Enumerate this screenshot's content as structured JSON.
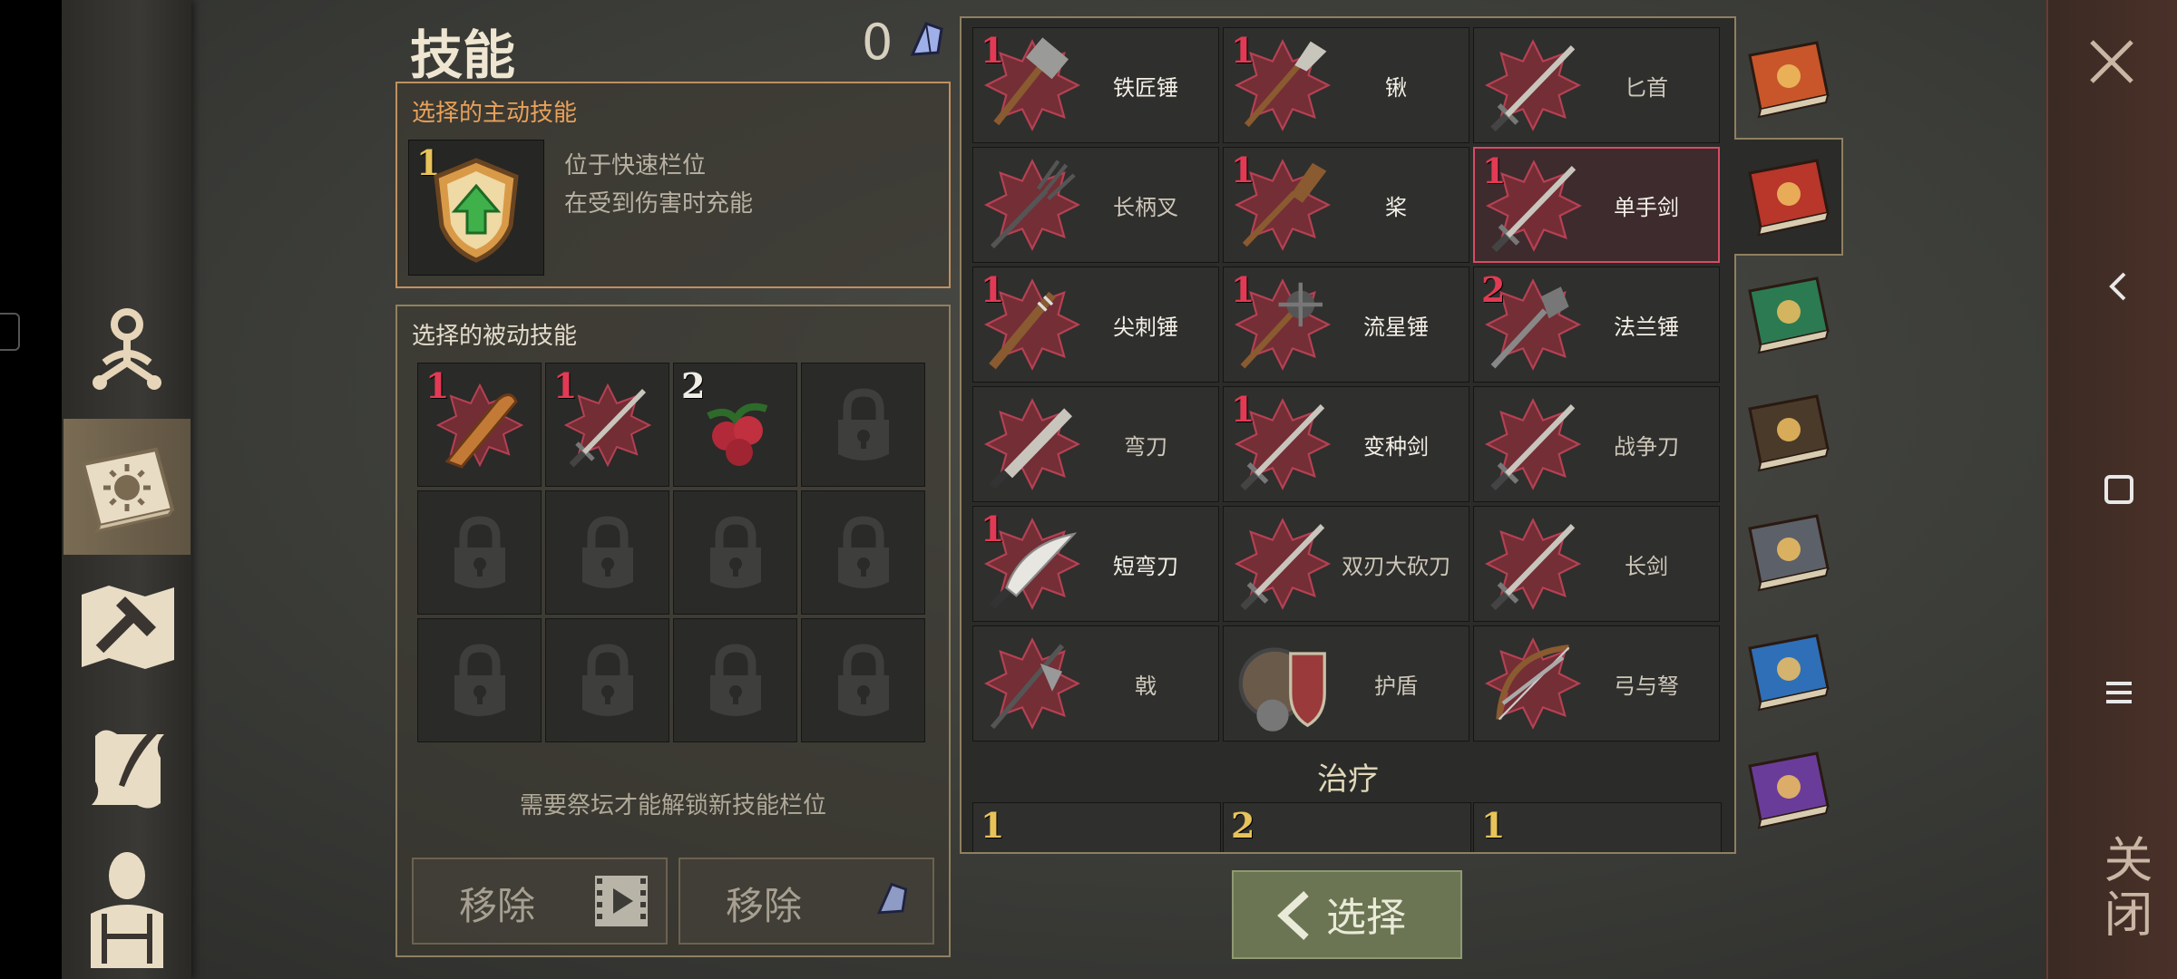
{
  "header": {
    "title": "技能",
    "points": "0"
  },
  "active_skill": {
    "title": "选择的主动技能",
    "level": "1",
    "desc_line1": "位于快速栏位",
    "desc_line2": "在受到伤害时充能"
  },
  "passive_skills": {
    "title": "选择的被动技能",
    "slots": [
      {
        "level": "1",
        "icon": "club-icon"
      },
      {
        "level": "1",
        "icon": "sword-icon"
      },
      {
        "level": "2",
        "icon": "berries-icon"
      },
      {
        "icon": "lock-icon"
      },
      {
        "icon": "lock-icon"
      },
      {
        "icon": "lock-icon"
      },
      {
        "icon": "lock-icon"
      },
      {
        "icon": "lock-icon"
      },
      {
        "icon": "lock-icon"
      },
      {
        "icon": "lock-icon"
      },
      {
        "icon": "lock-icon"
      },
      {
        "icon": "lock-icon"
      }
    ],
    "hint": "需要祭坛才能解锁新技能栏位",
    "remove_video_label": "移除",
    "remove_gem_label": "移除"
  },
  "weapons": [
    {
      "name": "铁匠锤",
      "level": "1",
      "icon": "sledgehammer-icon"
    },
    {
      "name": "锹",
      "level": "1",
      "icon": "shovel-icon"
    },
    {
      "name": "匕首",
      "level": "",
      "icon": "dagger-icon"
    },
    {
      "name": "长柄叉",
      "level": "",
      "icon": "pitchfork-icon"
    },
    {
      "name": "桨",
      "level": "1",
      "icon": "oar-icon"
    },
    {
      "name": "单手剑",
      "level": "1",
      "icon": "one-handed-sword-icon",
      "selected": true
    },
    {
      "name": "尖刺锤",
      "level": "1",
      "icon": "spiked-club-icon"
    },
    {
      "name": "流星锤",
      "level": "1",
      "icon": "morning-star-icon"
    },
    {
      "name": "法兰锤",
      "level": "2",
      "icon": "flanged-mace-icon"
    },
    {
      "name": "弯刀",
      "level": "",
      "icon": "machete-icon"
    },
    {
      "name": "变种剑",
      "level": "1",
      "icon": "mutant-sword-icon"
    },
    {
      "name": "战争刀",
      "level": "",
      "icon": "war-blade-icon"
    },
    {
      "name": "短弯刀",
      "level": "1",
      "icon": "short-scimitar-icon"
    },
    {
      "name": "双刃大砍刀",
      "level": "",
      "icon": "twin-blade-cleaver-icon"
    },
    {
      "name": "长剑",
      "level": "",
      "icon": "longsword-icon"
    },
    {
      "name": "戟",
      "level": "",
      "icon": "halberd-icon"
    },
    {
      "name": "护盾",
      "level": "",
      "icon": "shield-icon"
    },
    {
      "name": "弓与弩",
      "level": "",
      "icon": "bow-crossbow-icon"
    }
  ],
  "healing": {
    "title": "治疗",
    "peek_levels": [
      "1",
      "2",
      "1"
    ]
  },
  "book_tabs": [
    {
      "icon": "sun-book-icon",
      "color": "#c8562a"
    },
    {
      "icon": "sword-book-icon",
      "color": "#b8362a"
    },
    {
      "icon": "cross-book-icon",
      "color": "#2c7a52"
    },
    {
      "icon": "mask-book-icon",
      "color": "#4a3a2a"
    },
    {
      "icon": "crossbow-book-icon",
      "color": "#5c6068"
    },
    {
      "icon": "shield-book-icon",
      "color": "#2f6fb8"
    },
    {
      "icon": "arrows-book-icon",
      "color": "#6a3c9a"
    }
  ],
  "select_button": {
    "label": "选择"
  },
  "close_panel": {
    "label": "关闭"
  },
  "colors": {
    "level_red": "#e23a55",
    "selected_border": "#d64c63",
    "accent_orange": "#e9a15a",
    "select_green": "#6b7553"
  }
}
